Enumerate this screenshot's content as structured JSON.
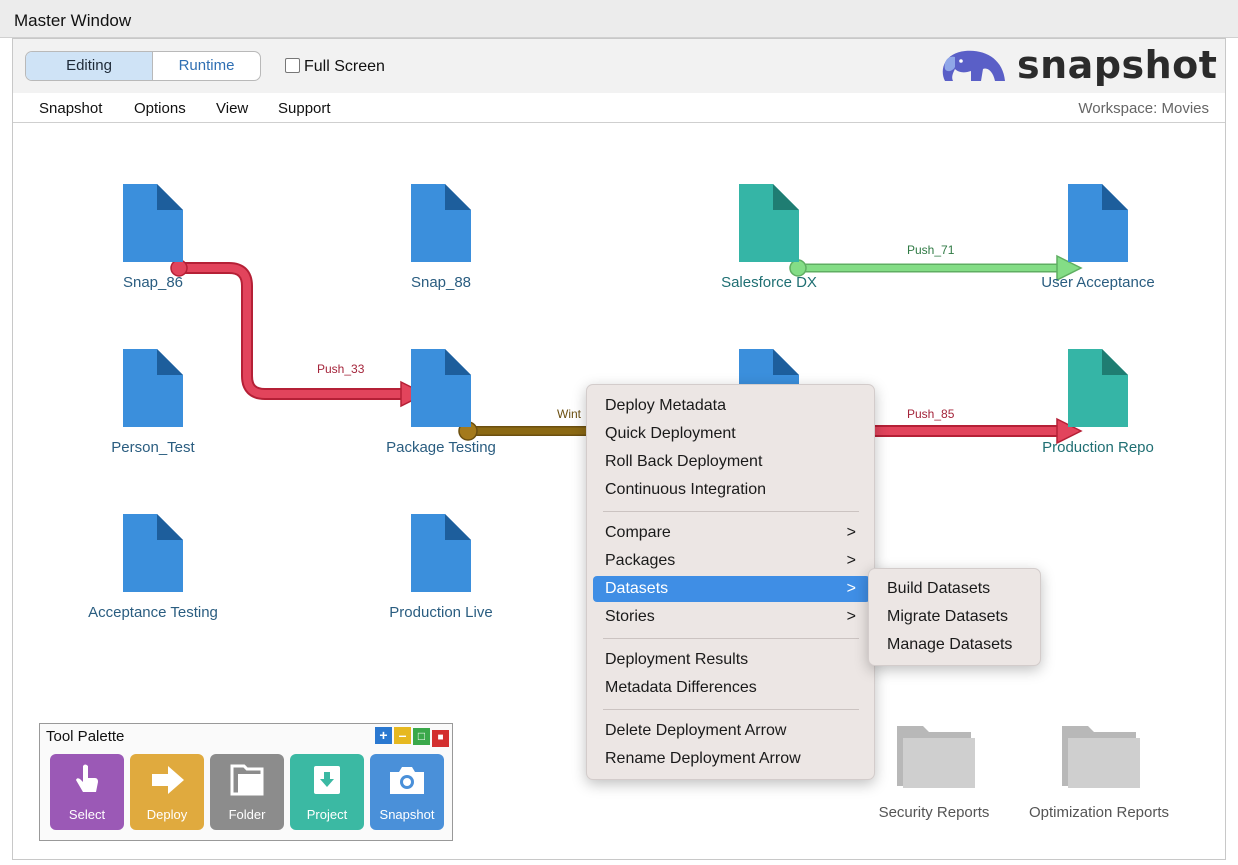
{
  "window": {
    "title": "Master Window"
  },
  "toolbar": {
    "modes": [
      "Editing",
      "Runtime"
    ],
    "selected_mode": "Editing",
    "full_screen_label": "Full Screen",
    "full_screen_checked": false,
    "logo_text": "snapshot"
  },
  "menubar": {
    "items": [
      "Snapshot",
      "Options",
      "View",
      "Support"
    ],
    "workspace": "Workspace: Movies"
  },
  "colors": {
    "doc_blue": "#3b8fdc",
    "doc_teal": "#35b5a6",
    "arrow_red": "#e2445c",
    "arrow_green": "#7bd67d",
    "arrow_brown": "#8b6914",
    "menu_highlight": "#3f8ee5"
  },
  "canvas": {
    "nodes": [
      {
        "label": "Snap_86",
        "icon": "blue-document-icon"
      },
      {
        "label": "Snap_88",
        "icon": "blue-document-icon"
      },
      {
        "label": "Salesforce DX",
        "icon": "teal-document-icon"
      },
      {
        "label": "User Acceptance",
        "icon": "blue-document-icon"
      },
      {
        "label": "Person_Test",
        "icon": "blue-document-icon"
      },
      {
        "label": "Package Testing",
        "icon": "blue-document-icon"
      },
      {
        "label": "Production Repo",
        "icon": "teal-document-icon"
      },
      {
        "label": "Acceptance Testing",
        "icon": "blue-document-icon"
      },
      {
        "label": "Production Live",
        "icon": "blue-document-icon"
      },
      {
        "label": "Security Reports",
        "icon": "folder-icon"
      },
      {
        "label": "Optimization Reports",
        "icon": "folder-icon"
      }
    ],
    "arrows": [
      {
        "label": "Push_33",
        "from": "Snap_86",
        "to": "Package Testing",
        "color": "red"
      },
      {
        "label": "Push_71",
        "from": "Salesforce DX",
        "to": "User Acceptance",
        "color": "green"
      },
      {
        "label": "Push_85",
        "to": "Production Repo",
        "color": "red"
      },
      {
        "label": "Wint",
        "from": "Package Testing",
        "color": "brown"
      }
    ]
  },
  "tool_palette": {
    "title": "Tool Palette",
    "window_buttons": [
      "+",
      "–",
      "□",
      "■"
    ],
    "tools": [
      {
        "label": "Select",
        "icon": "hand-pointer-icon",
        "color": "#9b59b6"
      },
      {
        "label": "Deploy",
        "icon": "arrow-right-icon",
        "color": "#e0aa3e"
      },
      {
        "label": "Folder",
        "icon": "folder-icon",
        "color": "#8c8c8c"
      },
      {
        "label": "Project",
        "icon": "download-box-icon",
        "color": "#3bb9a3"
      },
      {
        "label": "Snapshot",
        "icon": "camera-icon",
        "color": "#4a90d9"
      }
    ]
  },
  "context_menu": {
    "items": [
      "Deploy Metadata",
      "Quick Deployment",
      "Roll Back Deployment",
      "Continuous Integration",
      "Compare",
      "Packages",
      "Datasets",
      "Stories",
      "Deployment Results",
      "Metadata Differences",
      "Delete Deployment Arrow",
      "Rename Deployment Arrow"
    ],
    "submenu_items": [
      "Compare",
      "Packages",
      "Datasets",
      "Stories"
    ],
    "highlighted": "Datasets",
    "submenu_chevron": ">"
  },
  "datasets_submenu": {
    "items": [
      "Build Datasets",
      "Migrate Datasets",
      "Manage Datasets"
    ]
  }
}
